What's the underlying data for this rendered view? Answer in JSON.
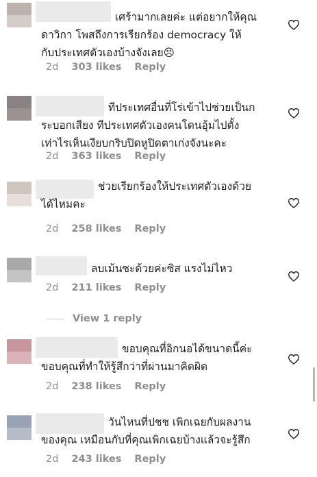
{
  "comments": [
    {
      "lines": [
        "เศร้ามากเลยค่ะ แต่อยากให้คุณ",
        "ดาวิกา โพสถึงการเรียกร้อง democracy ให้",
        "กับประเทศตัวเองบ้างจังเลย😣"
      ],
      "time": "2d",
      "likes": "303 likes",
      "reply": "Reply",
      "avatar_colors": [
        "#bdb2ac",
        "#d4ccc7"
      ]
    },
    {
      "lines": [
        "ทีประเทศอื่นที่โร่เข้าไปช่วยเป็นก",
        "ระบอกเสียง ทีประเทศตัวเองคนโดนอุ้มไปตั้ง",
        "เท่าไรเห็นเงียบกริบปิดหูปิดตาเก่งจังนะคะ"
      ],
      "time": "2d",
      "likes": "363 likes",
      "reply": "Reply",
      "avatar_colors": [
        "#8a8282",
        "#9b9291"
      ]
    },
    {
      "lines": [
        "ช่วยเรียกร้องให้ประเทศตัวเองด้วย",
        "ได้ไหมคะ"
      ],
      "time": "2d",
      "likes": "258 likes",
      "reply": "Reply",
      "avatar_colors": [
        "#cfc7bf",
        "#e8dedb"
      ]
    },
    {
      "lines": [
        "ลบเม้นซะด้วยค่ะซิส แรงไม่ไหว"
      ],
      "time": "2d",
      "likes": "211 likes",
      "reply": "Reply",
      "avatar_colors": [
        "#a9a9a9",
        "#c4c4c4"
      ]
    },
    {
      "lines": [
        "ขอบคุณที่อิกนอได้ขนาดนี้ค่ะ",
        "ขอบคุณที่ทำให้รู้สึกว่าที่ผ่านมาคิดผิด"
      ],
      "time": "2d",
      "likes": "238 likes",
      "reply": "Reply",
      "avatar_colors": [
        "#c9959c",
        "#d9b3b8"
      ]
    },
    {
      "lines": [
        "วันไหนที่ปชช เพิกเฉยกับผลงาน",
        "ของคุณ เหมือนกับที่คุณเพิกเฉยบ้างแล้วจะรู้สึก"
      ],
      "time": "2d",
      "likes": "243 likes",
      "reply": "Reply",
      "avatar_colors": [
        "#98a3b3",
        "#b3bcc8"
      ]
    }
  ],
  "view_replies": "View 1 reply"
}
